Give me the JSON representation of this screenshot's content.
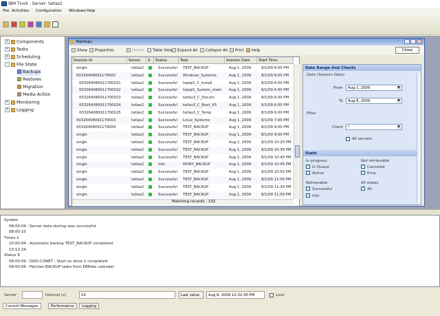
{
  "window": {
    "title": "IBM Tivoli - Server: tatlas2"
  },
  "menu": [
    "File",
    "Activities",
    "Configuration",
    "Windows",
    "Help"
  ],
  "tree": {
    "items": [
      {
        "label": "Components",
        "indent": 0,
        "toggle": "+"
      },
      {
        "label": "Tasks",
        "indent": 0,
        "toggle": "+"
      },
      {
        "label": "Scheduling",
        "indent": 0,
        "toggle": "+"
      },
      {
        "label": "File State",
        "indent": 0,
        "toggle": "-"
      },
      {
        "label": "Backups",
        "indent": 1,
        "toggle": ""
      },
      {
        "label": "Restores",
        "indent": 1,
        "toggle": ""
      },
      {
        "label": "Migration",
        "indent": 1,
        "toggle": ""
      },
      {
        "label": "Media Action",
        "indent": 1,
        "toggle": ""
      },
      {
        "label": "Monitoring",
        "indent": 0,
        "toggle": "+"
      },
      {
        "label": "Logging",
        "indent": 0,
        "toggle": "+"
      }
    ]
  },
  "backups": {
    "title": "Backups",
    "toolbar": [
      "Show",
      "Properties",
      "Delete",
      "Table View",
      "Expand All",
      "Collapse All",
      "Print",
      "Help"
    ],
    "close_label": "Close",
    "columns": [
      "Session Id",
      "Server",
      "S",
      "Status",
      "Task",
      "Session Date",
      "Start Time"
    ],
    "rows": [
      [
        "single",
        "tatlas2",
        "",
        "Successful",
        "TEST_BACKUP",
        "Aug 1, 2009",
        "8/1/09 6:00 PM"
      ],
      [
        "00326408091170002",
        "tatlas2",
        "",
        "Successful",
        "Windows_Systems",
        "Aug 1, 2009",
        "8/1/09 6:00 PM"
      ],
      [
        "003264080911700021",
        "tatlas2",
        "",
        "Successful",
        "hqsql1_C_install",
        "Aug 1, 2009",
        "8/1/09 6:00 PM"
      ],
      [
        "003264080911700022",
        "tatlas2",
        "",
        "Successful",
        "hqsql1_System_state",
        "Aug 1, 2009",
        "8/1/09 6:00 PM"
      ],
      [
        "003264080911700023",
        "tatlas2",
        "",
        "Successful",
        "tatlas3_C_Docum",
        "Aug 1, 2009",
        "8/1/09 6:00 PM"
      ],
      [
        "003264080911700024",
        "tatlas2",
        "",
        "Successful",
        "tatlas3_C_Boot_VS",
        "Aug 1, 2009",
        "8/1/09 6:00 PM"
      ],
      [
        "003264080911700025",
        "tatlas2",
        "",
        "Successful",
        "tatlas1_C_Temp",
        "Aug 1, 2009",
        "8/1/09 6:00 PM"
      ],
      [
        "00326408091170003",
        "tatlas2",
        "",
        "Successful",
        "Linux_Systems",
        "Aug 1, 2009",
        "8/1/09 7:00 PM"
      ],
      [
        "00326408091170004",
        "tatlas2",
        "",
        "Successful",
        "TEST_BACKUP",
        "Aug 1, 2009",
        "8/1/09 8:00 PM"
      ],
      [
        "single",
        "tatlas2",
        "",
        "Successful",
        "TEST_BACKUP",
        "Aug 1, 2009",
        "8/1/09 9:00 PM"
      ],
      [
        "single",
        "tatlas2",
        "",
        "Successful",
        "TEST_BACKUP",
        "Aug 1, 2009",
        "8/1/09 10:20 PM"
      ],
      [
        "single",
        "tatlas2",
        "",
        "Successful",
        "TEST_BACKUP",
        "Aug 1, 2009",
        "8/1/09 10:30 PM"
      ],
      [
        "single",
        "tatlas2",
        "",
        "Successful",
        "TEST_BACKUP",
        "Aug 1, 2009",
        "8/1/09 10:40 PM"
      ],
      [
        "single",
        "tatlas2",
        "",
        "Info",
        "MONY_BACKUP",
        "Aug 1, 2009",
        "8/1/09 10:45 PM"
      ],
      [
        "single",
        "tatlas2",
        "",
        "Successful",
        "TEST_BACKUP",
        "Aug 1, 2009",
        "8/1/09 10:50 PM"
      ],
      [
        "single",
        "tatlas2",
        "",
        "Successful",
        "TEST_BACKUP",
        "Aug 1, 2009",
        "8/1/09 11:00 PM"
      ],
      [
        "single",
        "tatlas2",
        "",
        "Successful",
        "TEST_BACKUP",
        "Aug 1, 2009",
        "8/1/09 11:30 PM"
      ],
      [
        "single",
        "tatlas2",
        "",
        "Successful",
        "TEST_BACKUP",
        "Aug 1, 2009",
        "8/1/09 11:50 PM"
      ]
    ],
    "matching": "Matching records : 102"
  },
  "filter_panel": {
    "date_header": "Date Range And Clients",
    "date_section": "Date (Session Date)",
    "from_label": "From",
    "from_value": "Aug 1, 2009",
    "to_label": "To",
    "to_value": "Aug 8, 2009",
    "filter_label": "Filter",
    "client_label": "Client",
    "client_value": "*",
    "all_servers": "All servers",
    "state_header": "State",
    "state_left": [
      {
        "label": "In progress",
        "checked": false
      },
      {
        "label": "In Queue",
        "checked": true
      },
      {
        "label": "Active",
        "checked": true
      },
      {
        "label": "Retrievable",
        "checked": false
      },
      {
        "label": "Successful",
        "checked": true
      },
      {
        "label": "Info",
        "checked": true
      }
    ],
    "state_right": [
      {
        "label": "Not retrievable",
        "checked": false
      },
      {
        "label": "Canceled",
        "checked": true
      },
      {
        "label": "Error",
        "checked": true
      },
      {
        "label": "All states",
        "checked": false
      },
      {
        "label": "All",
        "checked": true
      }
    ]
  },
  "log": {
    "lines": [
      {
        "text": "System",
        "indent": 0
      },
      {
        "text": "08:00:04 : Server data startup was successful",
        "indent": 1
      },
      {
        "text": "08:00:10",
        "indent": 1
      },
      {
        "text": "Times 1",
        "indent": 0
      },
      {
        "text": "10:00:04 : Automatic backup TEST_BACKUP completed",
        "indent": 1
      },
      {
        "text": "10:12:24",
        "indent": 1
      },
      {
        "text": "Status 9",
        "indent": 0
      },
      {
        "text": "08:00:09 : DDO-CONET : Start on drive 2 completed",
        "indent": 1
      },
      {
        "text": "08:00:09 : Fetches BACKUP tasks from EBRate calendar",
        "indent": 1
      }
    ]
  },
  "status": {
    "server_label": "Server",
    "server_value": "",
    "interval_label": "Interval (s)",
    "interval_value": "10",
    "last_value_label": "Last value",
    "timestamp": "Aug 8, 2009 12:32:30 PM",
    "lock_label": "Lock"
  },
  "bottom_tabs": [
    "Current Messages",
    "Performance",
    "Logging"
  ]
}
